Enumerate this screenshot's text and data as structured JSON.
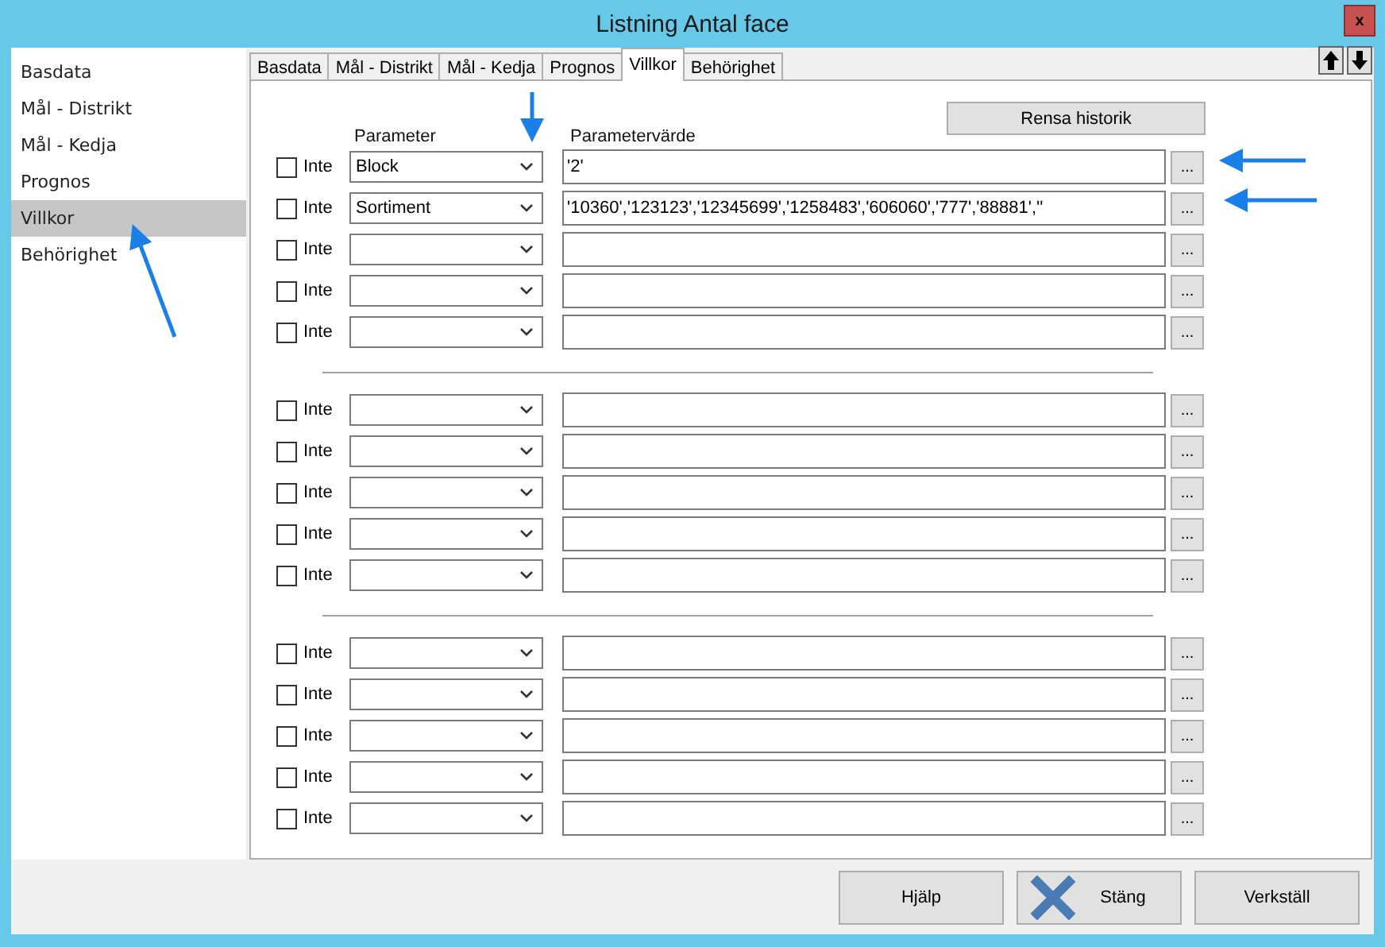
{
  "window": {
    "title": "Listning Antal face",
    "close": "x"
  },
  "sidebar": {
    "items": [
      {
        "label": "Basdata",
        "selected": false
      },
      {
        "label": "Mål - Distrikt",
        "selected": false
      },
      {
        "label": "Mål - Kedja",
        "selected": false
      },
      {
        "label": "Prognos",
        "selected": false
      },
      {
        "label": "Villkor",
        "selected": true
      },
      {
        "label": "Behörighet",
        "selected": false
      }
    ]
  },
  "tabs": [
    {
      "label": "Basdata",
      "selected": false
    },
    {
      "label": "Mål - Distrikt",
      "selected": false
    },
    {
      "label": "Mål - Kedja",
      "selected": false
    },
    {
      "label": "Prognos",
      "selected": false
    },
    {
      "label": "Villkor",
      "selected": true
    },
    {
      "label": "Behörighet",
      "selected": false
    }
  ],
  "clear_history_button": "Rensa historik",
  "columns": {
    "parameter": "Parameter",
    "value": "Parametervärde"
  },
  "groups": [
    {
      "rows": [
        {
          "checked": false,
          "label": "Inte",
          "parameter": "Block",
          "value": "'2'",
          "browse": "..."
        },
        {
          "checked": false,
          "label": "Inte",
          "parameter": "Sortiment",
          "value": "'10360','123123','12345699','1258483','606060','777','88881',''",
          "browse": "..."
        },
        {
          "checked": false,
          "label": "Inte",
          "browse": "..."
        },
        {
          "checked": false,
          "label": "Inte",
          "browse": "..."
        },
        {
          "checked": false,
          "label": "Inte",
          "browse": "..."
        }
      ]
    },
    {
      "rows": [
        {
          "checked": false,
          "label": "Inte",
          "browse": "..."
        },
        {
          "checked": false,
          "label": "Inte",
          "browse": "..."
        },
        {
          "checked": false,
          "label": "Inte",
          "browse": "..."
        },
        {
          "checked": false,
          "label": "Inte",
          "browse": "..."
        },
        {
          "checked": false,
          "label": "Inte",
          "browse": "..."
        }
      ]
    },
    {
      "rows": [
        {
          "checked": false,
          "label": "Inte",
          "browse": "..."
        },
        {
          "checked": false,
          "label": "Inte",
          "browse": "..."
        },
        {
          "checked": false,
          "label": "Inte",
          "browse": "..."
        },
        {
          "checked": false,
          "label": "Inte",
          "browse": "..."
        },
        {
          "checked": false,
          "label": "Inte",
          "browse": "..."
        }
      ]
    }
  ],
  "buttons": [
    {
      "label": "Hjälp",
      "icon": false
    },
    {
      "label": "Stäng",
      "icon": true
    },
    {
      "label": "Verkställ",
      "icon": false
    }
  ]
}
